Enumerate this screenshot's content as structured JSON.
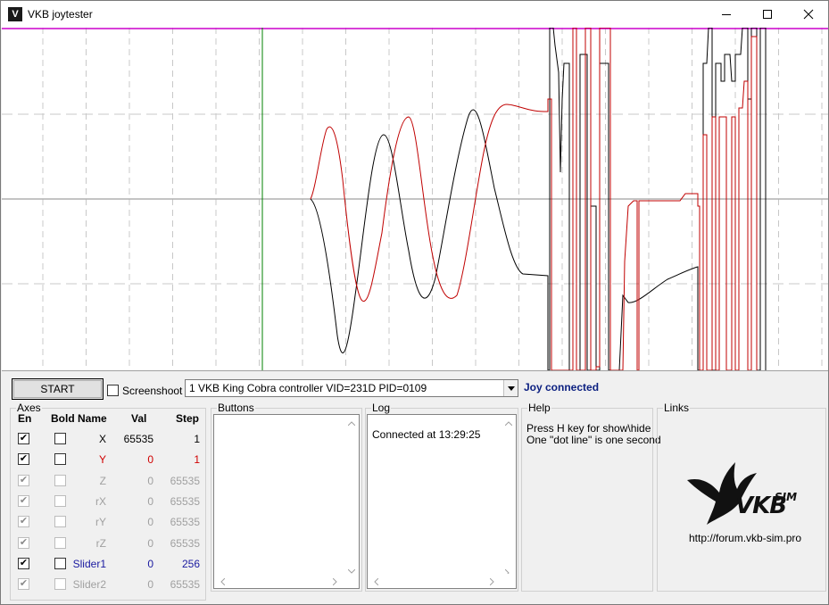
{
  "window": {
    "title": "VKB joytester",
    "icon": "vkb-logo-icon",
    "controls": [
      "minimize-icon",
      "maximize-icon",
      "close-icon"
    ]
  },
  "toolbar": {
    "start_label": "START",
    "screenshoot_label": "Screenshoot",
    "screenshoot_checked": false,
    "device_selected": "1 VKB King Cobra controller VID=231D PID=0109",
    "status": "Joy connected"
  },
  "axes": {
    "title": "Axes",
    "headers": {
      "en": "En",
      "bold": "Bold",
      "name": "Name",
      "val": "Val",
      "step": "Step"
    },
    "rows": [
      {
        "name": "X",
        "val": "65535",
        "step": "1",
        "en": true,
        "bold": false,
        "enabled": true,
        "color": "#000000"
      },
      {
        "name": "Y",
        "val": "0",
        "step": "1",
        "en": true,
        "bold": false,
        "enabled": true,
        "color": "#d00000"
      },
      {
        "name": "Z",
        "val": "0",
        "step": "65535",
        "en": true,
        "bold": false,
        "enabled": false,
        "color": "#a0a0a0"
      },
      {
        "name": "rX",
        "val": "0",
        "step": "65535",
        "en": true,
        "bold": false,
        "enabled": false,
        "color": "#a0a0a0"
      },
      {
        "name": "rY",
        "val": "0",
        "step": "65535",
        "en": true,
        "bold": false,
        "enabled": false,
        "color": "#a0a0a0"
      },
      {
        "name": "rZ",
        "val": "0",
        "step": "65535",
        "en": true,
        "bold": false,
        "enabled": false,
        "color": "#a0a0a0"
      },
      {
        "name": "Slider1",
        "val": "0",
        "step": "256",
        "en": true,
        "bold": false,
        "enabled": true,
        "color": "#1a1aa0"
      },
      {
        "name": "Slider2",
        "val": "0",
        "step": "65535",
        "en": true,
        "bold": false,
        "enabled": false,
        "color": "#a0a0a0"
      }
    ]
  },
  "buttons_group": {
    "title": "Buttons"
  },
  "log": {
    "title": "Log",
    "lines": [
      "Connected at 13:29:25"
    ]
  },
  "help": {
    "title": "Help",
    "lines": [
      "Press H key for show\\hide",
      "One \"dot line\" is one second"
    ]
  },
  "links": {
    "title": "Links",
    "url": "http://forum.vkb-sim.pro",
    "logo_text": "VKB",
    "logo_sup": "SIM"
  },
  "colors": {
    "plot_bg": "#ffffff",
    "grid": "#c8c8c8",
    "center_line": "#b0b0b0",
    "top_line": "#cc00cc",
    "cursor_line": "#008000",
    "series_x": "#000000",
    "series_y": "#c00000",
    "status": "#0b1f80"
  }
}
